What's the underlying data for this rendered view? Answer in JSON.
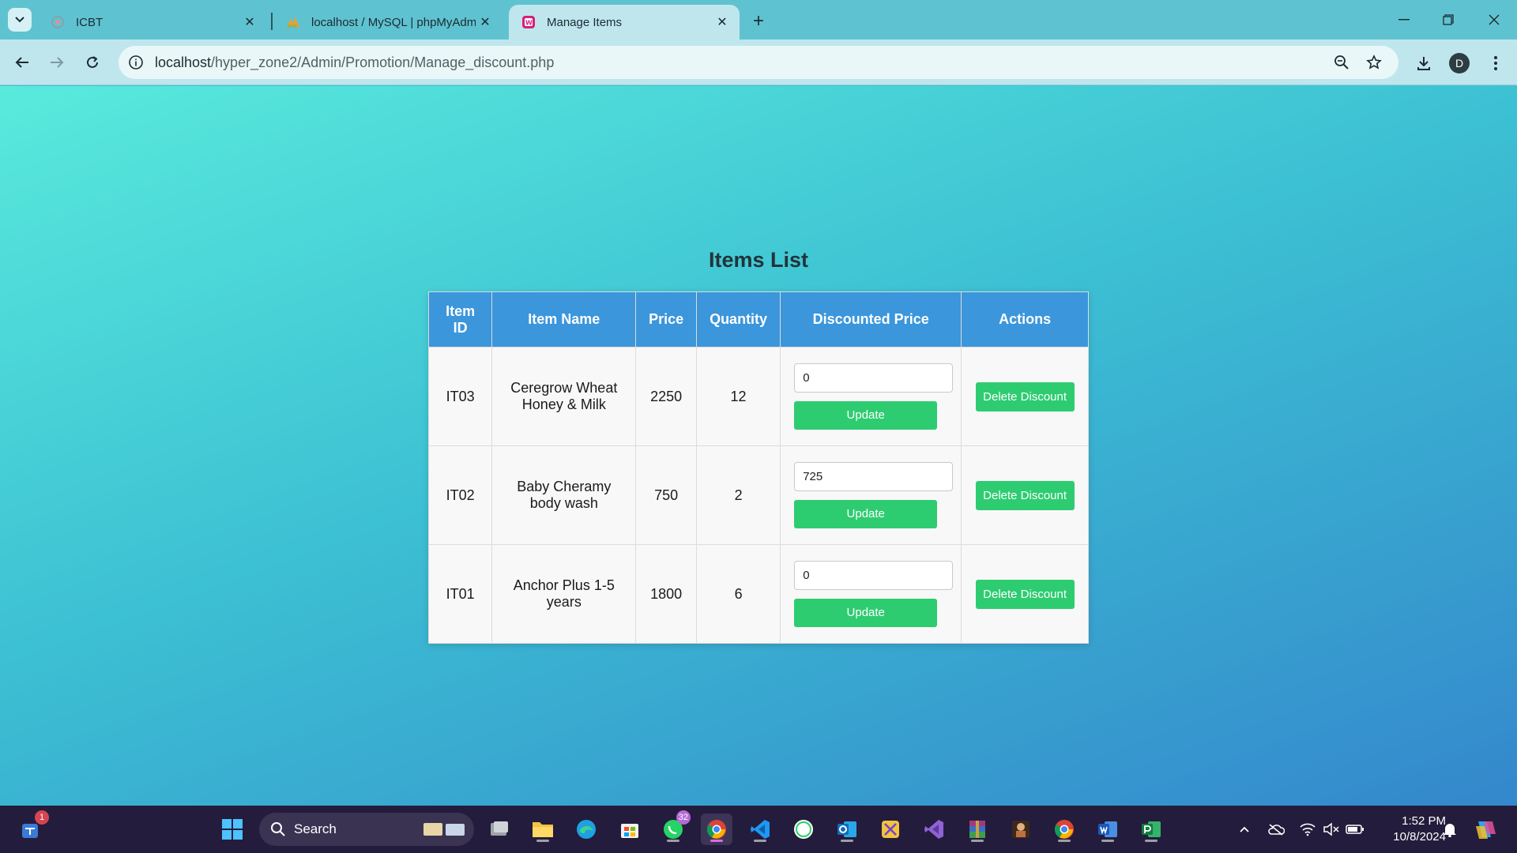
{
  "browser": {
    "tabs": [
      {
        "title": "ICBT",
        "active": false
      },
      {
        "title": "localhost / MySQL | phpMyAdmin",
        "active": false
      },
      {
        "title": "Manage Items",
        "active": true
      }
    ],
    "url_host": "localhost",
    "url_path": "/hyper_zone2/Admin/Promotion/Manage_discount.php",
    "profile_initial": "D"
  },
  "page": {
    "heading": "Items List",
    "columns": [
      "Item ID",
      "Item Name",
      "Price",
      "Quantity",
      "Discounted Price",
      "Actions"
    ],
    "rows": [
      {
        "id": "IT03",
        "name": "Ceregrow Wheat Honey & Milk",
        "price": "2250",
        "quantity": "12",
        "discounted_price": "0",
        "update_label": "Update",
        "delete_label": "Delete Discount"
      },
      {
        "id": "IT02",
        "name": "Baby Cheramy body wash",
        "price": "750",
        "quantity": "2",
        "discounted_price": "725",
        "update_label": "Update",
        "delete_label": "Delete Discount"
      },
      {
        "id": "IT01",
        "name": "Anchor Plus 1-5 years",
        "price": "1800",
        "quantity": "6",
        "discounted_price": "0",
        "update_label": "Update",
        "delete_label": "Delete Discount"
      }
    ],
    "colors": {
      "header": "#3b96dc",
      "button": "#2ecc71"
    }
  },
  "taskbar": {
    "search_label": "Search",
    "teams_badge": "1",
    "whatsapp_badge": "32",
    "time": "1:52 PM",
    "date": "10/8/2024"
  }
}
